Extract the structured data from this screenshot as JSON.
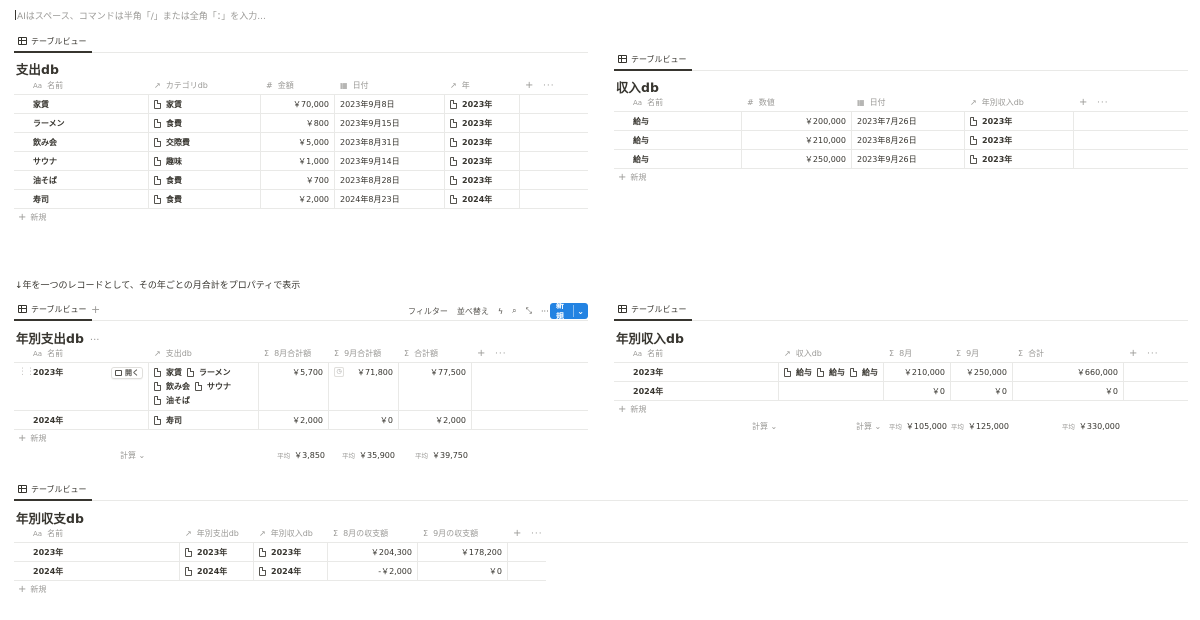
{
  "prompt": "AIはスペース、コマンドは半角「/」または全角「：」を入力...",
  "note": "↓年を一つのレコードとして、その年ごとの月合計をプロパティで表示",
  "view_tab": "テーブルビュー",
  "common": {
    "new_row": "新規",
    "calc": "計算",
    "avg": "平均"
  },
  "toolbar": {
    "filter": "フィルター",
    "sort": "並べ替え",
    "new": "新規"
  },
  "open_label": "開く",
  "expense_db": {
    "title": "支出db",
    "columns": [
      "名前",
      "カテゴリdb",
      "金額",
      "日付",
      "年"
    ],
    "rows": [
      {
        "name": "家賃",
        "category": "家賃",
        "amount": "￥70,000",
        "date": "2023年9月8日",
        "year": "2023年"
      },
      {
        "name": "ラーメン",
        "category": "食費",
        "amount": "￥800",
        "date": "2023年9月15日",
        "year": "2023年"
      },
      {
        "name": "飲み会",
        "category": "交際費",
        "amount": "￥5,000",
        "date": "2023年8月31日",
        "year": "2023年"
      },
      {
        "name": "サウナ",
        "category": "趣味",
        "amount": "￥1,000",
        "date": "2023年9月14日",
        "year": "2023年"
      },
      {
        "name": "油そば",
        "category": "食費",
        "amount": "￥700",
        "date": "2023年8月28日",
        "year": "2023年"
      },
      {
        "name": "寿司",
        "category": "食費",
        "amount": "￥2,000",
        "date": "2024年8月23日",
        "year": "2024年"
      }
    ]
  },
  "income_db": {
    "title": "収入db",
    "columns": [
      "名前",
      "数値",
      "日付",
      "年別収入db"
    ],
    "rows": [
      {
        "name": "給与",
        "value": "￥200,000",
        "date": "2023年7月26日",
        "year": "2023年"
      },
      {
        "name": "給与",
        "value": "￥210,000",
        "date": "2023年8月26日",
        "year": "2023年"
      },
      {
        "name": "給与",
        "value": "￥250,000",
        "date": "2023年9月26日",
        "year": "2023年"
      }
    ]
  },
  "yearly_expense_db": {
    "title": "年別支出db",
    "columns": [
      "名前",
      "支出db",
      "8月合計額",
      "9月合計額",
      "合計額"
    ],
    "rows": [
      {
        "name": "2023年",
        "items": [
          "家賃",
          "ラーメン",
          "飲み会",
          "サウナ",
          "油そば"
        ],
        "aug": "￥5,700",
        "sep": "￥71,800",
        "total": "￥77,500"
      },
      {
        "name": "2024年",
        "items": [
          "寿司"
        ],
        "aug": "￥2,000",
        "sep": "￥0",
        "total": "￥2,000"
      }
    ],
    "averages": {
      "aug": "￥3,850",
      "sep": "￥35,900",
      "total": "￥39,750"
    }
  },
  "yearly_income_db": {
    "title": "年別収入db",
    "columns": [
      "名前",
      "収入db",
      "8月",
      "9月",
      "合計"
    ],
    "rows": [
      {
        "name": "2023年",
        "items": [
          "給与",
          "給与",
          "給与"
        ],
        "aug": "￥210,000",
        "sep": "￥250,000",
        "total": "￥660,000"
      },
      {
        "name": "2024年",
        "items": [],
        "aug": "￥0",
        "sep": "￥0",
        "total": "￥0"
      }
    ],
    "averages": {
      "aug": "￥105,000",
      "sep": "￥125,000",
      "total": "￥330,000"
    }
  },
  "yearly_balance_db": {
    "title": "年別収支db",
    "columns": [
      "名前",
      "年別支出db",
      "年別収入db",
      "8月の収支額",
      "9月の収支額"
    ],
    "rows": [
      {
        "name": "2023年",
        "expense": "2023年",
        "income": "2023年",
        "aug": "￥204,300",
        "sep": "￥178,200"
      },
      {
        "name": "2024年",
        "expense": "2024年",
        "income": "2024年",
        "aug": "-￥2,000",
        "sep": "￥0"
      }
    ]
  }
}
